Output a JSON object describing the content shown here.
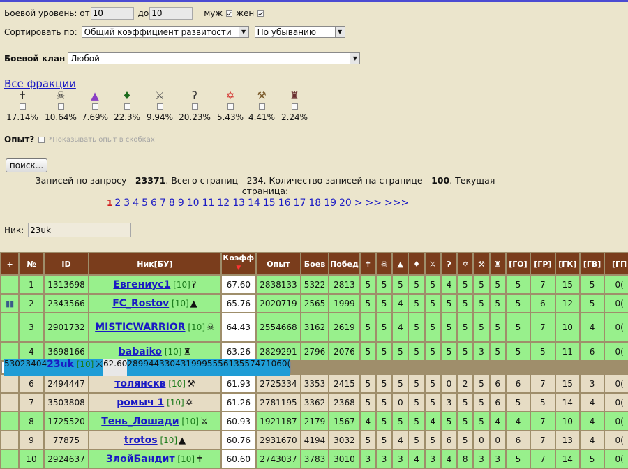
{
  "filters": {
    "level_label": "Боевой уровень: от",
    "level_from": "10",
    "level_to_label": "до",
    "level_to": "10",
    "male_label": "муж",
    "female_label": "жен",
    "sort_label": "Сортировать по:",
    "sort_by": "Общий коэффициент развитости",
    "sort_order": "По убыванию",
    "clan_label": "Боевой клан",
    "clan_value": "Любой",
    "all_factions": "Все фракции",
    "experience_label": "Опыт?",
    "experience_hint": "*Показывать опыт в скобках",
    "search_button": "поиск...",
    "nick_label": "Ник:",
    "nick_value": "23uk"
  },
  "factions": [
    {
      "icon": "cross-icon",
      "glyph": "✝",
      "pct": "17.14%",
      "color": "#222"
    },
    {
      "icon": "skull-helmet-icon",
      "glyph": "☠",
      "pct": "10.64%",
      "color": "#333"
    },
    {
      "icon": "wizard-hat-icon",
      "glyph": "▲",
      "pct": "7.69%",
      "color": "#8a3fc4"
    },
    {
      "icon": "leaf-icon",
      "glyph": "♦",
      "pct": "22.3%",
      "color": "#1c6b1c"
    },
    {
      "icon": "sword-icon",
      "glyph": "⚔",
      "pct": "9.94%",
      "color": "#555"
    },
    {
      "icon": "scythe-icon",
      "glyph": "ʔ",
      "pct": "20.23%",
      "color": "#333"
    },
    {
      "icon": "pentagram-icon",
      "glyph": "✡",
      "pct": "5.43%",
      "color": "#d01a1a"
    },
    {
      "icon": "hammer-icon",
      "glyph": "⚒",
      "pct": "4.41%",
      "color": "#7a5a2a"
    },
    {
      "icon": "demon-icon",
      "glyph": "♜",
      "pct": "2.24%",
      "color": "#6a3030"
    }
  ],
  "summary": {
    "prefix": "Записей по запросу -",
    "total": "23371",
    "pages_text": ". Всего страниц - 234. Количество записей на странице -",
    "per_page": "100",
    "suffix": ". Текущая",
    "line2": "страница:"
  },
  "pagination": {
    "current": "1",
    "pages": [
      "2",
      "3",
      "4",
      "5",
      "6",
      "7",
      "8",
      "9",
      "10",
      "11",
      "12",
      "13",
      "14",
      "15",
      "16",
      "17",
      "18",
      "19",
      "20",
      ">",
      ">>",
      ">>>"
    ]
  },
  "table": {
    "headers": [
      "+",
      "№",
      "ID",
      "Ник[БУ]",
      "Коэфф",
      "Опыт",
      "Боев",
      "Побед",
      "✝",
      "☠",
      "▲",
      "♦",
      "⚔",
      "ʔ",
      "✡",
      "⚒",
      "♜",
      "[ГО]",
      "[ГР]",
      "[ГК]",
      "[ГВ]",
      "[ГП"
    ],
    "rows": [
      {
        "n": "1",
        "id": "1313698",
        "nick": "Евгениус1",
        "lvl": "[10]",
        "icon": "scythe-icon",
        "glyph": "ʔ",
        "coef": "67.60",
        "exp": "2838133",
        "battles": "5322",
        "wins": "2813",
        "f": [
          "5",
          "5",
          "5",
          "5",
          "5",
          "4",
          "5",
          "5",
          "5"
        ],
        "g": [
          "5",
          "7",
          "15",
          "5",
          "0("
        ]
      },
      {
        "n": "2",
        "id": "2343566",
        "nick": "FC_Rostov",
        "lvl": "[10]",
        "icon": "wizard-hat-icon",
        "glyph": "▲",
        "coef": "65.76",
        "exp": "2020719",
        "battles": "2565",
        "wins": "1999",
        "f": [
          "5",
          "5",
          "4",
          "5",
          "5",
          "5",
          "5",
          "5",
          "5"
        ],
        "g": [
          "5",
          "6",
          "12",
          "5",
          "0("
        ],
        "plus": "chart-icon"
      },
      {
        "n": "3",
        "id": "2901732",
        "nick": "MISTICWARRIOR",
        "lvl": "[10]",
        "icon": "skull-helmet-icon",
        "glyph": "☠",
        "coef": "64.43",
        "exp": "2554668",
        "battles": "3162",
        "wins": "2619",
        "f": [
          "5",
          "5",
          "4",
          "5",
          "5",
          "5",
          "5",
          "5",
          "5"
        ],
        "g": [
          "5",
          "7",
          "10",
          "4",
          "0("
        ],
        "tall": true
      },
      {
        "n": "4",
        "id": "3698166",
        "nick": "babaiko",
        "lvl": "[10]",
        "icon": "demon-icon",
        "glyph": "♜",
        "coef": "63.26",
        "exp": "2829291",
        "battles": "2796",
        "wins": "2076",
        "f": [
          "5",
          "5",
          "5",
          "5",
          "5",
          "5",
          "5",
          "3",
          "5"
        ],
        "g": [
          "5",
          "5",
          "11",
          "6",
          "0("
        ]
      },
      {
        "n": "5",
        "id": "3023404",
        "nick": "23uk",
        "lvl": "[10]",
        "icon": "sword-icon",
        "glyph": "⚔",
        "coef": "62.60",
        "exp": "2899443",
        "battles": "3043",
        "wins": "1999",
        "f": [
          "5",
          "5",
          "5",
          "6",
          "1",
          "3",
          "5",
          "5",
          "7"
        ],
        "g": [
          "4",
          "7",
          "10",
          "6",
          "0("
        ],
        "selected": true
      },
      {
        "n": "6",
        "id": "2494447",
        "nick": "толянскв",
        "lvl": "[10]",
        "icon": "hammer-icon",
        "glyph": "⚒",
        "coef": "61.93",
        "exp": "2725334",
        "battles": "3353",
        "wins": "2415",
        "f": [
          "5",
          "5",
          "5",
          "5",
          "5",
          "0",
          "2",
          "5",
          "6"
        ],
        "g": [
          "6",
          "7",
          "15",
          "3",
          "0("
        ],
        "grey": true
      },
      {
        "n": "7",
        "id": "3503808",
        "nick": "ромыч 1",
        "lvl": "[10]",
        "icon": "pentagram-icon",
        "glyph": "✡",
        "coef": "61.26",
        "exp": "2781195",
        "battles": "3362",
        "wins": "2368",
        "f": [
          "5",
          "5",
          "0",
          "5",
          "5",
          "3",
          "5",
          "5",
          "6"
        ],
        "g": [
          "5",
          "5",
          "14",
          "4",
          "0("
        ],
        "grey": true
      },
      {
        "n": "8",
        "id": "1725520",
        "nick": "Тень_Лошади",
        "lvl": "[10]",
        "icon": "sword-icon",
        "glyph": "⚔",
        "coef": "60.93",
        "exp": "1921187",
        "battles": "2179",
        "wins": "1567",
        "f": [
          "4",
          "5",
          "5",
          "5",
          "4",
          "5",
          "5",
          "5",
          "4"
        ],
        "g": [
          "4",
          "7",
          "10",
          "4",
          "0("
        ]
      },
      {
        "n": "9",
        "id": "77875",
        "nick": "trotos",
        "lvl": "[10]",
        "icon": "wizard-hat-icon",
        "glyph": "▲",
        "coef": "60.76",
        "exp": "2931670",
        "battles": "4194",
        "wins": "3032",
        "f": [
          "5",
          "5",
          "4",
          "5",
          "5",
          "6",
          "5",
          "0",
          "0"
        ],
        "g": [
          "6",
          "7",
          "13",
          "4",
          "0("
        ],
        "grey": true
      },
      {
        "n": "10",
        "id": "2924637",
        "nick": "ЗлойБандит",
        "lvl": "[10]",
        "icon": "cross-icon",
        "glyph": "✝",
        "coef": "60.60",
        "exp": "2743037",
        "battles": "3783",
        "wins": "3010",
        "f": [
          "3",
          "3",
          "3",
          "4",
          "3",
          "4",
          "8",
          "3",
          "3"
        ],
        "g": [
          "5",
          "7",
          "14",
          "5",
          "0("
        ]
      }
    ]
  }
}
